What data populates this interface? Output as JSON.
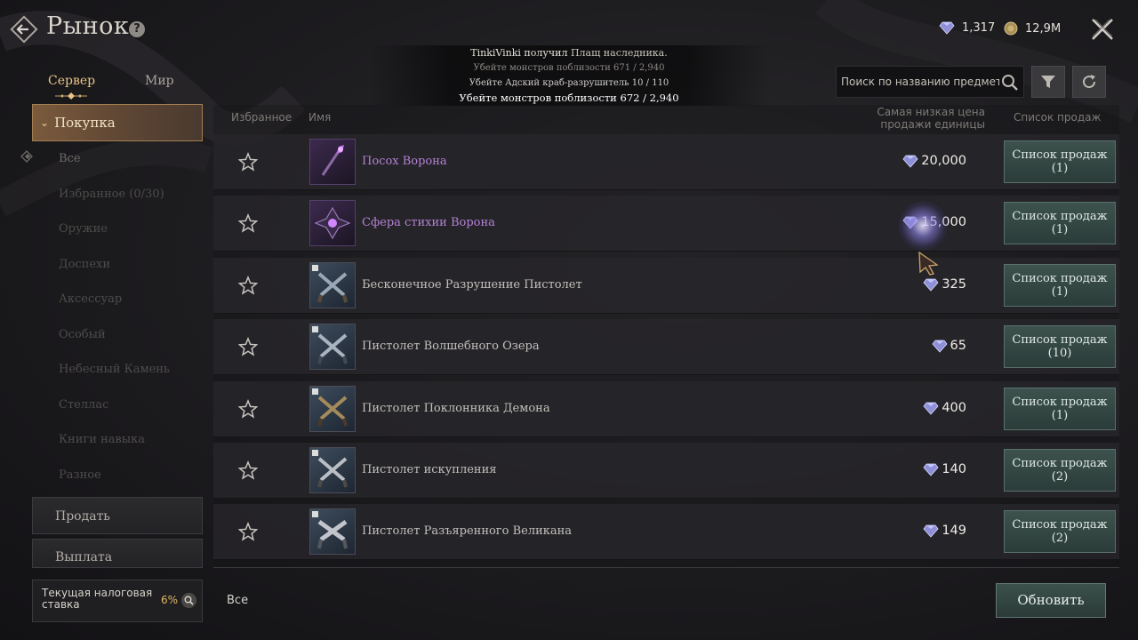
{
  "header": {
    "title": "Рынок",
    "help_glyph": "?",
    "diamonds": "1,317",
    "gold": "12,9M"
  },
  "notifications": {
    "line1_player": "TinkiVinki получил",
    "line1_item": "Плащ наследника.",
    "line2": "Убейте монстров поблизости 671 / 2,940",
    "line3": "Убейте Адский краб-разрушитель 10 / 110",
    "line4": "Убейте монстров поблизости 672 / 2,940"
  },
  "tabs": {
    "server": "Сервер",
    "world": "Мир"
  },
  "sidebar": {
    "buy_label": "Покупка",
    "sub_items": [
      "Все",
      "Избранное (0/30)",
      "Оружие",
      "Доспехи",
      "Аксессуар",
      "Особый",
      "Небесный Камень",
      "Стеллас",
      "Книги навыка",
      "Разное"
    ],
    "sell_label": "Продать",
    "payout_label": "Выплата",
    "tax_label": "Текущая налоговая ставка",
    "tax_value": "6%"
  },
  "search": {
    "placeholder": "Поиск по названию предмета"
  },
  "table": {
    "col_favorite": "Избранное",
    "col_name": "Имя",
    "col_price_line1": "Самая низкая цена",
    "col_price_line2": "продажи единицы",
    "col_listings": "Список продаж",
    "rows": [
      {
        "name": "Посох Ворона",
        "price": "20,000",
        "btn": "Список продаж",
        "count": "(1)",
        "rarity": "epic"
      },
      {
        "name": "Сфера стихии Ворона",
        "price": "15,000",
        "btn": "Список продаж",
        "count": "(1)",
        "rarity": "epic"
      },
      {
        "name": "Бесконечное Разрушение Пистолет",
        "price": "325",
        "btn": "Список продаж",
        "count": "(1)",
        "rarity": "common"
      },
      {
        "name": "Пистолет Волшебного Озера",
        "price": "65",
        "btn": "Список продаж",
        "count": "(10)",
        "rarity": "common"
      },
      {
        "name": "Пистолет Поклонника Демона",
        "price": "400",
        "btn": "Список продаж",
        "count": "(1)",
        "rarity": "common"
      },
      {
        "name": "Пистолет искупления",
        "price": "140",
        "btn": "Список продаж",
        "count": "(2)",
        "rarity": "common"
      },
      {
        "name": "Пистолет Разъяренного Великана",
        "price": "149",
        "btn": "Список продаж",
        "count": "(2)",
        "rarity": "common"
      }
    ]
  },
  "footer": {
    "all_label": "Все",
    "refresh_label": "Обновить"
  },
  "icons": [
    "back-arrow-icon",
    "help-icon",
    "diamond-icon",
    "gold-coin-icon",
    "close-icon",
    "search-icon",
    "filter-icon",
    "refresh-icon",
    "star-icon",
    "chevron-down-icon"
  ],
  "colors": {
    "accent_gold": "#e8c585",
    "epic_purple": "#b681d6",
    "button_teal": "#3d524d"
  }
}
